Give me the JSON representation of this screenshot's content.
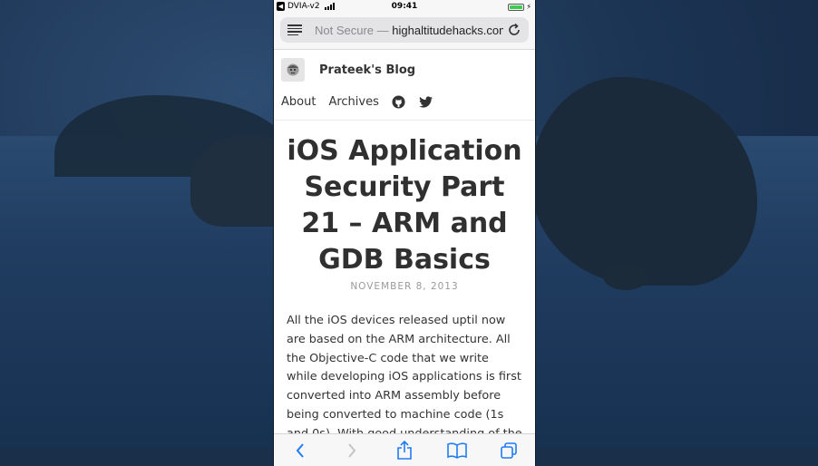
{
  "status_bar": {
    "carrier": "DVIA-v2",
    "time": "09:41",
    "battery_level": 1.0
  },
  "browser": {
    "url_prefix": "Not Secure — ",
    "url_domain": "highaltitudehacks.com"
  },
  "blog": {
    "title": "Prateek's Blog",
    "nav": [
      "About",
      "Archives"
    ],
    "nav_icons": [
      "github-icon",
      "twitter-icon"
    ]
  },
  "post": {
    "title": "iOS Application Security Part 21 – ARM and GDB Basics",
    "date": "NOVEMBER 8, 2013",
    "body": "All the iOS devices released uptil now are based on the ARM architecture. All the Objective-C code that we write while developing iOS applications is first converted into ARM assembly before being converted to machine code (1s and 0s). With good understanding of the ARM assembly"
  },
  "toolbar": {
    "icons": [
      "back-icon",
      "forward-icon",
      "share-icon",
      "bookmarks-icon",
      "tabs-icon"
    ]
  },
  "colors": {
    "accent": "#1e7cf6",
    "battery": "#3ecb4f"
  }
}
